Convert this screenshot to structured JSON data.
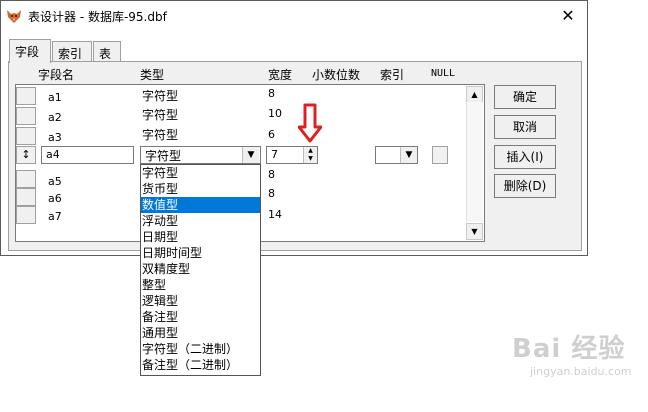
{
  "window": {
    "title": "表设计器 - 数据库-95.dbf",
    "close_glyph": "✕"
  },
  "tabs": [
    {
      "label": "字段"
    },
    {
      "label": "索引"
    },
    {
      "label": "表"
    }
  ],
  "headers": {
    "name": "字段名",
    "type": "类型",
    "width": "宽度",
    "decimals": "小数位数",
    "index": "索引",
    "null": "NULL"
  },
  "rows": [
    {
      "name": "a1",
      "type": "字符型",
      "width": "8"
    },
    {
      "name": "a2",
      "type": "字符型",
      "width": "10"
    },
    {
      "name": "a3",
      "type": "字符型",
      "width": "6"
    },
    {
      "name": "a4",
      "type": "字符型",
      "width": "7",
      "selector": "↕"
    },
    {
      "name": "a5",
      "type": "",
      "width": "8"
    },
    {
      "name": "a6",
      "type": "",
      "width": "8"
    },
    {
      "name": "a7",
      "type": "",
      "width": "14"
    }
  ],
  "type_options": [
    "字符型",
    "货币型",
    "数值型",
    "浮动型",
    "日期型",
    "日期时间型",
    "双精度型",
    "整型",
    "逻辑型",
    "备注型",
    "通用型",
    "字符型（二进制）",
    "备注型（二进制）"
  ],
  "selected_option_index": 2,
  "buttons": {
    "ok": "确定",
    "cancel": "取消",
    "insert": "插入(I)",
    "delete": "删除(D)"
  },
  "watermark": {
    "brand": "Bai 经验",
    "url": "jingyan.baidu.com"
  },
  "colors": {
    "highlight": "#0078d7",
    "arrow": "#e02020"
  }
}
